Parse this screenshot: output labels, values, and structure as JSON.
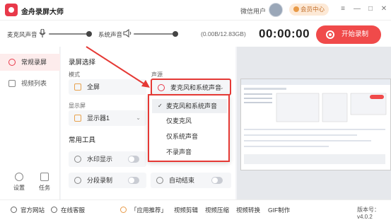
{
  "app": {
    "title": "金舟录屏大师",
    "user_label": "微信用户",
    "member_label": "会员中心"
  },
  "window_controls": {
    "menu": "≡",
    "minimize": "—",
    "maximize": "□",
    "close": "✕"
  },
  "audio": {
    "mic_label": "麦克风声音",
    "system_label": "系统声音",
    "storage": "(0.00B/12.83GB)",
    "timer": "00:00:00",
    "record_button": "开始录制"
  },
  "sidebar": {
    "items": [
      {
        "label": "常规录屏",
        "active": true
      },
      {
        "label": "视频列表",
        "active": false
      }
    ],
    "settings_label": "设置",
    "tasks_label": "任务"
  },
  "main": {
    "section_title": "录屏选择",
    "mode_label": "模式",
    "mode_value": "全屏",
    "audio_source_label": "声源",
    "audio_source_value": "麦克风和系统声音",
    "display_label": "显示屏",
    "display_value": "显示器1",
    "tools_title": "常用工具",
    "tools": [
      {
        "label": "水印显示"
      },
      {
        "label": "分段录制"
      },
      {
        "label": "自动结束"
      }
    ]
  },
  "dropdown": {
    "options": [
      "麦克风和系统声音",
      "仅麦克风",
      "仅系统声音",
      "不录声音"
    ],
    "selected_index": 0
  },
  "footer": {
    "website": "官方网站",
    "support": "在线客服",
    "recommend": "「应用推荐」",
    "links": [
      "视频剪辑",
      "视频压缩",
      "视频转换",
      "GIF制作"
    ],
    "version": "版本号：v4.0.2"
  },
  "colors": {
    "accent": "#f04a4a",
    "highlight_border": "#e53935",
    "member_bg": "#fde9d6"
  }
}
